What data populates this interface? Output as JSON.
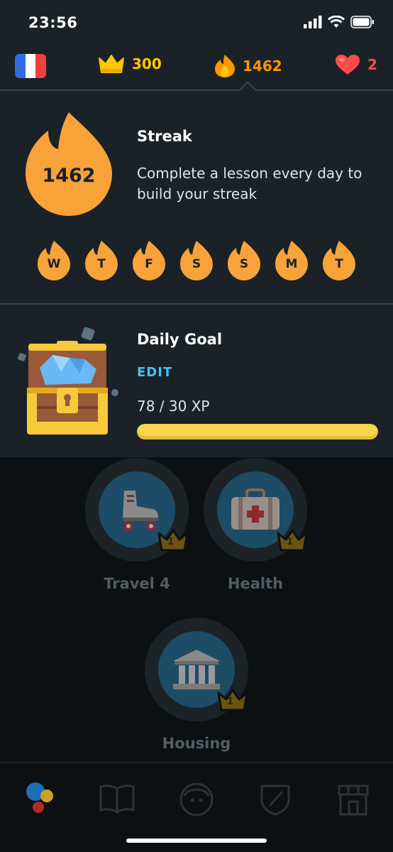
{
  "status_bar": {
    "time": "23:56"
  },
  "top_bar": {
    "language_flag": "france-flag",
    "crowns": "300",
    "streak": "1462",
    "hearts": "2",
    "colors": {
      "crown": "#ffc800",
      "streak": "#ff9600",
      "heart": "#ff4b4b"
    }
  },
  "streak_panel": {
    "count": "1462",
    "title": "Streak",
    "description": "Complete a lesson every day to build your streak",
    "days": [
      "W",
      "T",
      "F",
      "S",
      "S",
      "M",
      "T"
    ]
  },
  "daily_goal": {
    "title": "Daily Goal",
    "edit_label": "EDIT",
    "progress_text": "78 / 30 XP",
    "progress_fraction": 1.0
  },
  "skills": [
    {
      "label": "Travel 4",
      "icon": "roller-skate-icon",
      "level": "1"
    },
    {
      "label": "Health",
      "icon": "first-aid-kit-icon",
      "level": "1"
    },
    {
      "label": "Housing",
      "icon": "bank-building-icon",
      "level": "1"
    }
  ],
  "bottom_nav": [
    "learn-icon",
    "stories-icon",
    "profile-icon",
    "leagues-icon",
    "shop-icon"
  ]
}
